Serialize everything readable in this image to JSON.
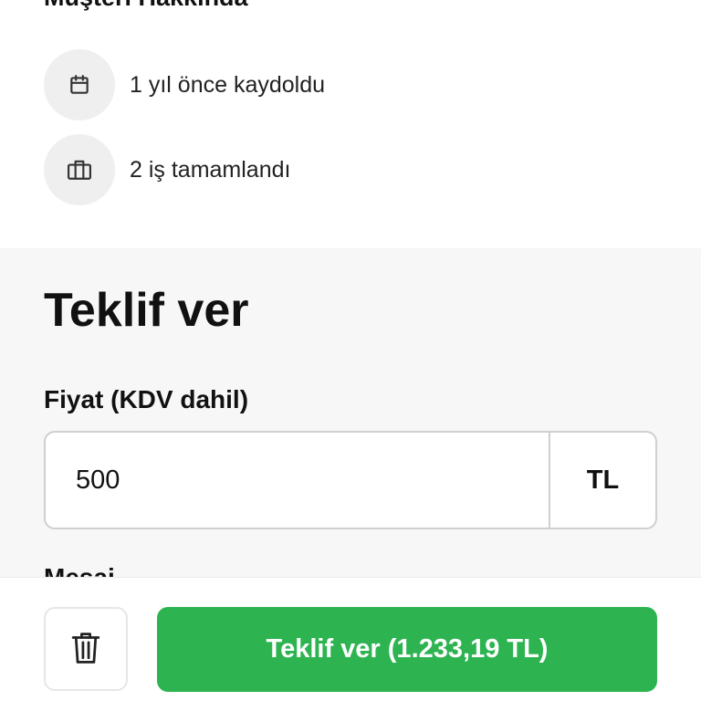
{
  "about": {
    "title": "Müşteri Hakkında",
    "items": [
      {
        "icon": "calendar-icon",
        "text": "1 yıl önce kaydoldu"
      },
      {
        "icon": "briefcase-icon",
        "text": "2 iş tamamlandı"
      }
    ]
  },
  "offer": {
    "title": "Teklif ver",
    "price_label": "Fiyat (KDV dahil)",
    "price_value": "500",
    "currency": "TL",
    "message_label": "Mesaj"
  },
  "footer": {
    "delete_icon": "trash-icon",
    "submit_label": "Teklif ver (1.233,19 TL)"
  },
  "colors": {
    "accent": "#2db451",
    "panel_background": "#f7f7f7",
    "icon_circle": "#efefef"
  }
}
